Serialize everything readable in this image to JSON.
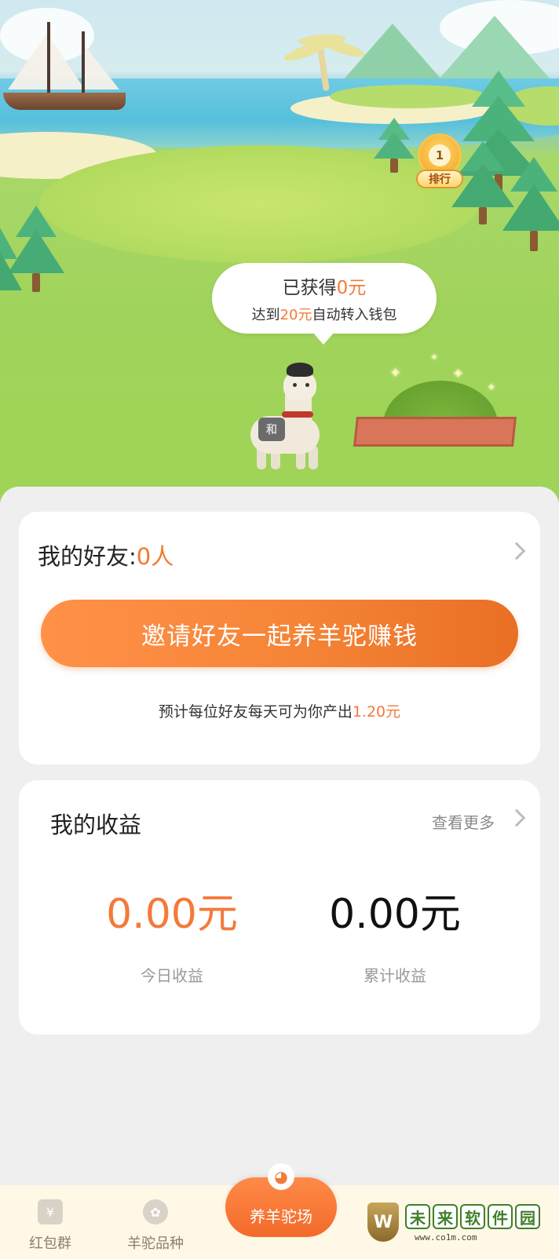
{
  "scene": {
    "rank_badge": {
      "rank_number": "1",
      "label": "排行"
    },
    "bubble": {
      "earned_prefix": "已获得",
      "earned_amount": "0元",
      "goal_prefix": "达到",
      "goal_amount": "20元",
      "goal_suffix": "自动转入钱包"
    },
    "alpaca_saddle_text": "和"
  },
  "friends": {
    "title": "我的好友:",
    "count": "0人",
    "invite_button": "邀请好友一起养羊驼赚钱",
    "hint_prefix": "预计每位好友每天可为你产出",
    "hint_amount": "1.20元"
  },
  "earnings": {
    "title": "我的收益",
    "more_link": "查看更多",
    "today_amount": "0.00元",
    "today_label": "今日收益",
    "total_amount": "0.00元",
    "total_label": "累计收益"
  },
  "bottom_nav": {
    "items": [
      {
        "label": "红包群",
        "icon": "red-envelope-icon",
        "glyph": "¥"
      },
      {
        "label": "羊驼品种",
        "icon": "breeds-icon",
        "glyph": "✿"
      },
      {
        "label": "养羊驼场",
        "icon": "alpaca-cat-icon",
        "glyph": "◕"
      }
    ]
  },
  "watermark": {
    "shield_letter": "W",
    "chars": [
      "未",
      "来",
      "软",
      "件",
      "园"
    ],
    "url": "www.co1m.com"
  },
  "colors": {
    "accent": "#f37a3a",
    "button_gradient_start": "#ff9148",
    "button_gradient_end": "#e96f24",
    "background": "#efefef"
  }
}
